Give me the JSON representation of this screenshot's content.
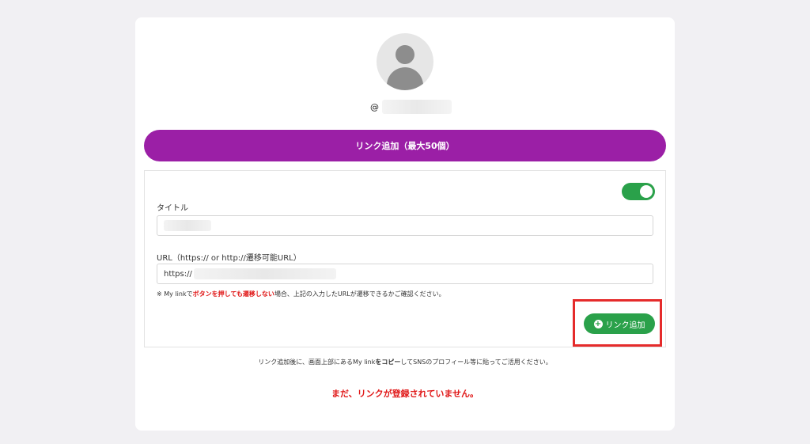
{
  "profile": {
    "username_prefix": "@"
  },
  "add_max_button": {
    "label": "リンク追加（最大50個）"
  },
  "form": {
    "title_label": "タイトル",
    "url_label": "URL（https:// or http://遷移可能URL）",
    "url_value": "https://",
    "note": {
      "prefix": "※ My linkで",
      "highlight": "ボタンを押しても遷移しない",
      "suffix": "場合、上記の入力したURLが遷移できるかご確認ください。"
    },
    "toggle_on": true,
    "add_button_label": "リンク追加"
  },
  "hint": {
    "before": "リンク追加後に、画面上部にあるMy link",
    "bold": "をコピー",
    "after": "してSNSのプロフィール等に貼ってご活用ください。"
  },
  "empty_message": "まだ、リンクが登録されていません。",
  "colors": {
    "purple": "#9b1fa6",
    "green": "#2aa14a",
    "red": "#e01616"
  }
}
